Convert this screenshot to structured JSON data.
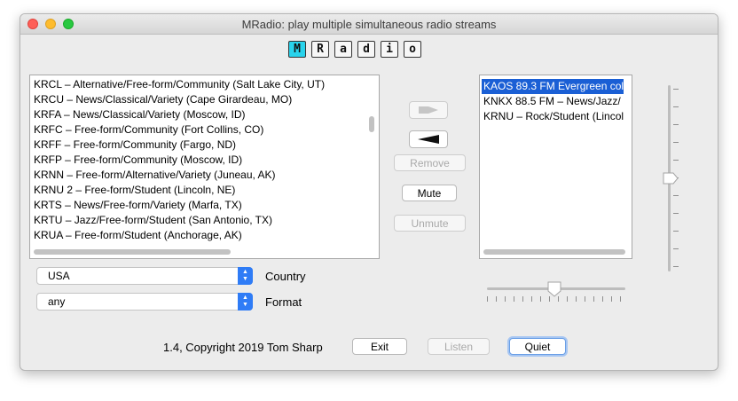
{
  "window": {
    "title": "MRadio: play multiple simultaneous radio streams"
  },
  "logo": {
    "letters": [
      "M",
      "R",
      "a",
      "d",
      "i",
      "o"
    ]
  },
  "stations": [
    "KRCL – Alternative/Free-form/Community (Salt Lake City, UT)",
    "KRCU – News/Classical/Variety (Cape Girardeau, MO)",
    "KRFA – News/Classical/Variety (Moscow, ID)",
    "KRFC – Free-form/Community (Fort Collins, CO)",
    "KRFF – Free-form/Community (Fargo, ND)",
    "KRFP – Free-form/Community (Moscow, ID)",
    "KRNN – Free-form/Alternative/Variety (Juneau, AK)",
    "KRNU 2 – Free-form/Student (Lincoln, NE)",
    "KRTS – News/Free-form/Variety (Marfa, TX)",
    "KRTU – Jazz/Free-form/Student (San Antonio, TX)",
    "KRUA – Free-form/Student (Anchorage, AK)"
  ],
  "playing": [
    "KAOS 89.3 FM Evergreen col",
    "KNKX 88.5 FM – News/Jazz/",
    "KRNU – Rock/Student (Lincol"
  ],
  "controls": {
    "play_icon": "play-arrow-icon",
    "mute_icon": "volume-wedge-icon",
    "remove": "Remove",
    "mute": "Mute",
    "unmute": "Unmute"
  },
  "filters": {
    "country_value": "USA",
    "country_label": "Country",
    "format_value": "any",
    "format_label": "Format"
  },
  "footer": {
    "copyright": "1.4, Copyright 2019 Tom Sharp",
    "exit": "Exit",
    "listen": "Listen",
    "quiet": "Quiet"
  },
  "colors": {
    "accent": "#2f7cf6",
    "selection": "#1a5fd5",
    "logo_highlight": "#29d3ec"
  }
}
